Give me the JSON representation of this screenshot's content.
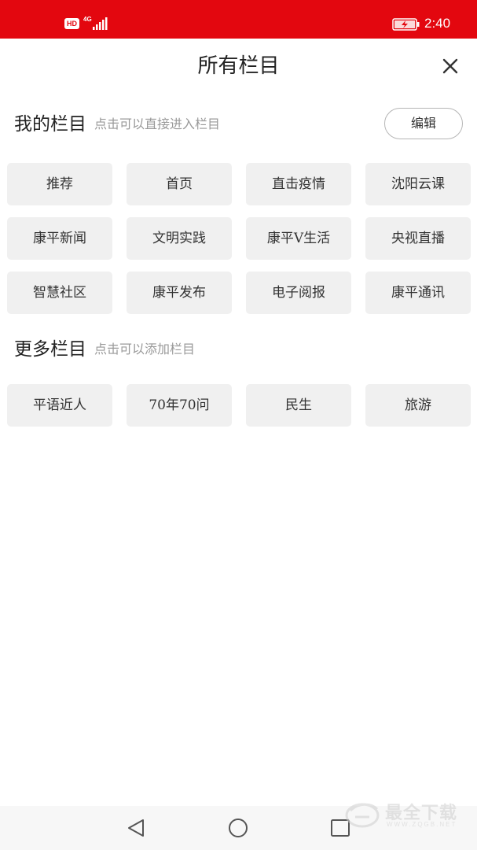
{
  "status_bar": {
    "hd_badge": "HD",
    "network": "4G",
    "time": "2:40",
    "icons": [
      "signal-icon",
      "battery-charging-icon"
    ],
    "background_color": "#e3070f"
  },
  "header": {
    "title": "所有栏目",
    "close_icon": "close-icon"
  },
  "my_channels": {
    "title": "我的栏目",
    "hint": "点击可以直接进入栏目",
    "edit_label": "编辑",
    "items": [
      "推荐",
      "首页",
      "直击疫情",
      "沈阳云课",
      "康平新闻",
      "文明实践",
      "康平V生活",
      "央视直播",
      "智慧社区",
      "康平发布",
      "电子阅报",
      "康平通讯"
    ]
  },
  "more_channels": {
    "title": "更多栏目",
    "hint": "点击可以添加栏目",
    "items": [
      "平语近人",
      "70年70问",
      "民生",
      "旅游"
    ]
  },
  "nav_bar": {
    "buttons": [
      "back-icon",
      "home-icon",
      "recent-apps-icon"
    ]
  },
  "watermark": {
    "text": "最全下载",
    "sub": "WWW.ZQGB.NET"
  }
}
